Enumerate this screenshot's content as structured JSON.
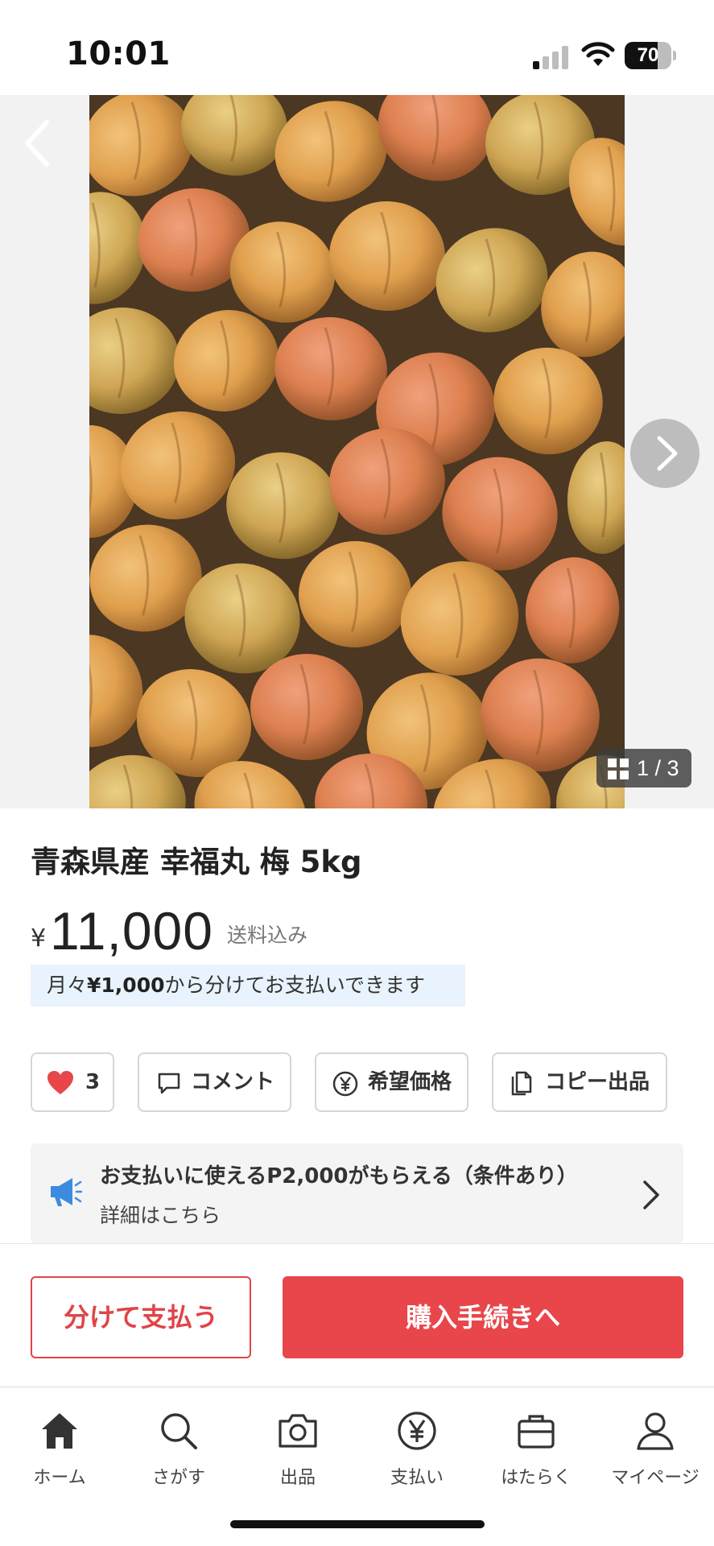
{
  "status_bar": {
    "time": "10:01",
    "battery_percent": "70",
    "battery_level": 0.7
  },
  "gallery": {
    "counter": "1 / 3"
  },
  "item": {
    "title": "青森県産 幸福丸 梅 5kg",
    "currency_symbol": "¥",
    "price": "11,000",
    "shipping": "送料込み",
    "installment_prefix": "月々",
    "installment_amount": "¥1,000",
    "installment_suffix": "から分けてお支払いできます"
  },
  "actions": {
    "like_count": "3",
    "comment_label": "コメント",
    "offer_label": "希望価格",
    "copy_label": "コピー出品"
  },
  "campaign": {
    "main_text": "お支払いに使えるP2,000がもらえる（条件あり）",
    "sub_text": "詳細はこちら"
  },
  "purchase": {
    "split_pay_label": "分けて支払う",
    "buy_label": "購入手続きへ"
  },
  "bottom_nav": {
    "items": [
      {
        "label": "ホーム",
        "icon": "home-icon"
      },
      {
        "label": "さがす",
        "icon": "search-icon"
      },
      {
        "label": "出品",
        "icon": "camera-icon"
      },
      {
        "label": "支払い",
        "icon": "yen-icon"
      },
      {
        "label": "はたらく",
        "icon": "briefcase-icon"
      },
      {
        "label": "マイページ",
        "icon": "person-icon"
      }
    ]
  },
  "colors": {
    "accent": "#e8464a",
    "info_bg": "#e8f3fd",
    "icon_blue": "#3d8be0"
  }
}
